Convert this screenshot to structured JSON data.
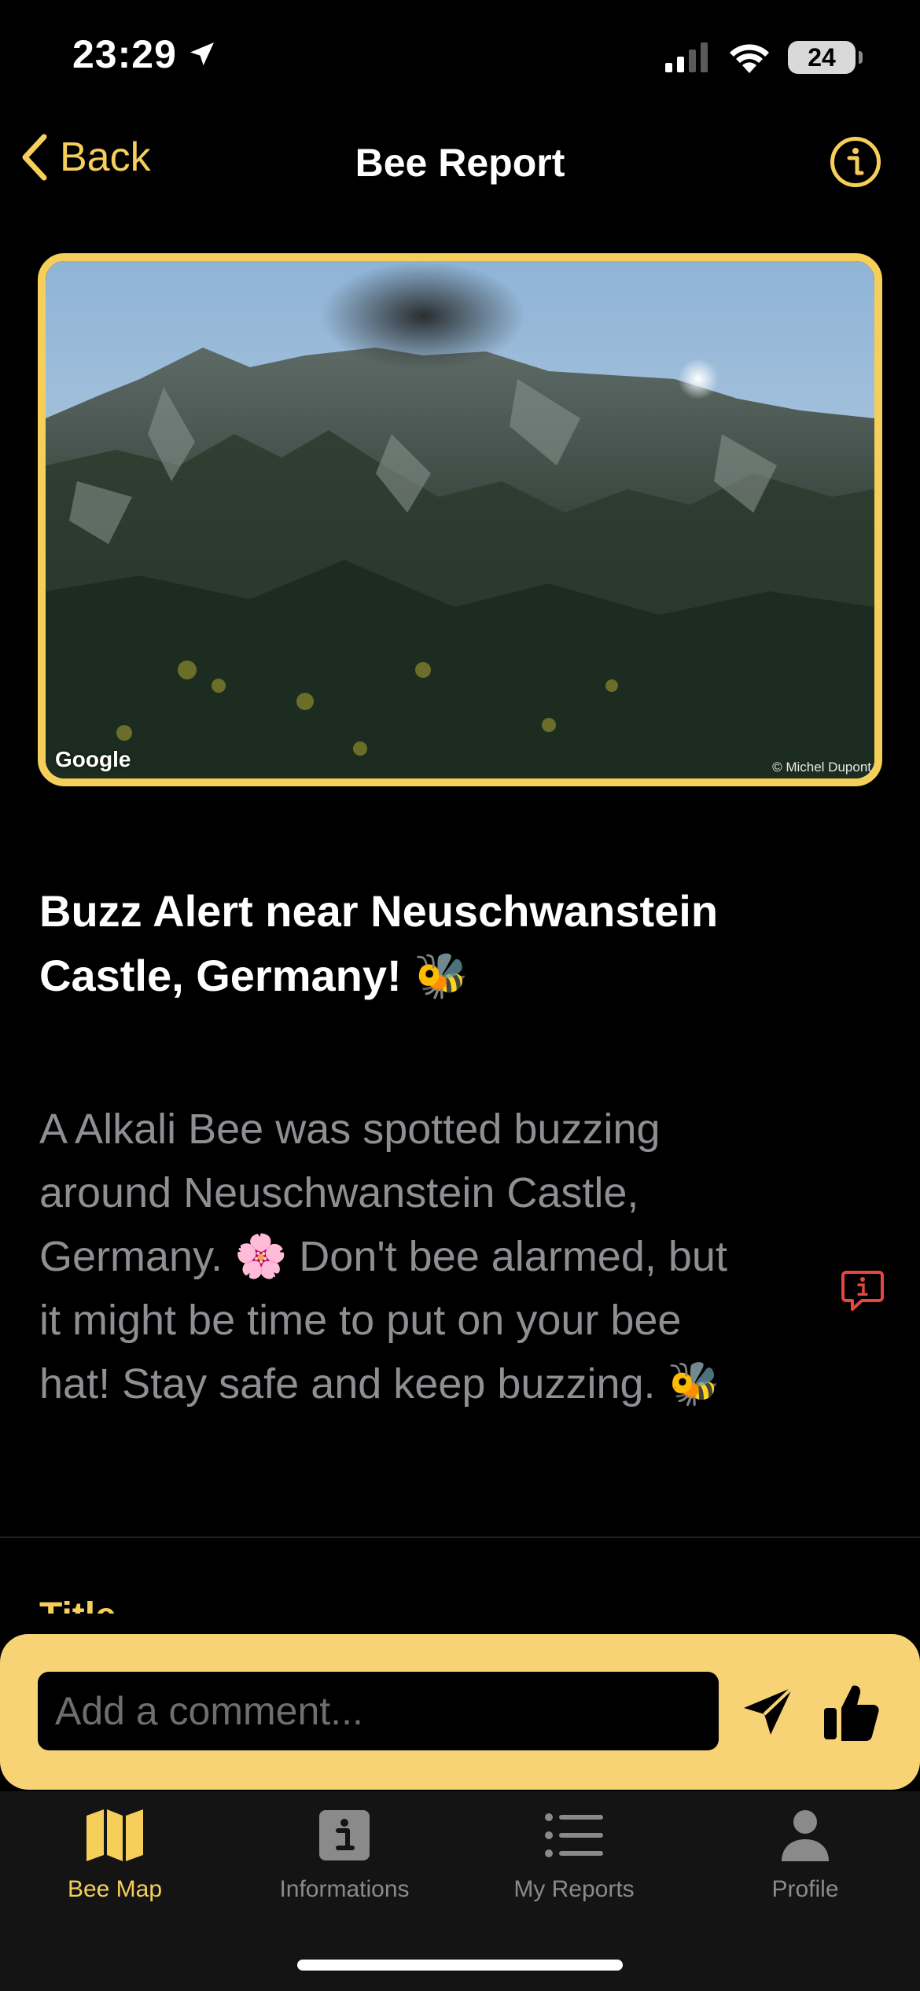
{
  "status_bar": {
    "time": "23:29",
    "battery": "24"
  },
  "nav": {
    "back_label": "Back",
    "title": "Bee Report"
  },
  "photo": {
    "google_credit": "Google",
    "author_credit": "© Michel Dupont"
  },
  "report": {
    "headline": "Buzz Alert near Neuschwanstein Castle, Germany! 🐝",
    "body": "A Alkali Bee was spotted buzzing around Neuschwanstein Castle, Germany. 🌸 Don't bee alarmed, but it might be time to put on your bee hat! Stay safe and keep buzzing. 🐝",
    "section_label": "Title"
  },
  "comment": {
    "placeholder": "Add a comment..."
  },
  "tabs": [
    {
      "label": "Bee Map",
      "icon": "map-icon",
      "active": true
    },
    {
      "label": "Informations",
      "icon": "info-square-icon",
      "active": false
    },
    {
      "label": "My Reports",
      "icon": "list-icon",
      "active": false
    },
    {
      "label": "Profile",
      "icon": "person-icon",
      "active": false
    }
  ],
  "colors": {
    "accent": "#f6cf5b",
    "comment_bar": "#f8d376",
    "alert_red": "#e5463f"
  }
}
